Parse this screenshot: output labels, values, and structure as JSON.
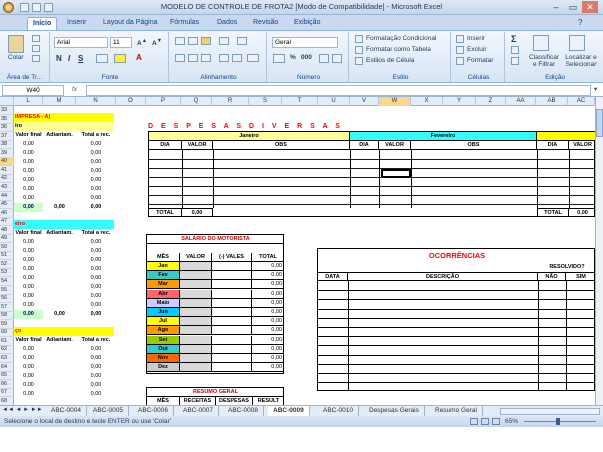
{
  "window": {
    "title": "MODELO DE CONTROLE DE FROTA2  [Modo de Compatibilidade] - Microsoft Excel"
  },
  "ribbon_tabs": [
    "Início",
    "Inserir",
    "Layout da Página",
    "Fórmulas",
    "Dados",
    "Revisão",
    "Exibição"
  ],
  "ribbon": {
    "paste": "Colar",
    "font_name": "Arial",
    "font_size": "11",
    "number_format": "Geral",
    "cond_format": "Formatação Condicional",
    "table_format": "Formatar como Tabela",
    "cell_styles": "Estilos de Célula",
    "insert": "Inserir",
    "delete": "Excluir",
    "format": "Formatar",
    "sort": "Classificar e Filtrar",
    "find": "Localizar e Selecionar",
    "groups": {
      "clipboard": "Área de Tr...",
      "font": "Fonte",
      "align": "Alinhamento",
      "number": "Número",
      "style": "Estilo",
      "cells": "Células",
      "edit": "Edição"
    }
  },
  "formula_bar": {
    "name_box": "W40",
    "fx": "fx"
  },
  "columns": [
    "L",
    "M",
    "N",
    "O",
    "P",
    "Q",
    "R",
    "S",
    "T",
    "U",
    "V",
    "W",
    "X",
    "Y",
    "Z",
    "AA",
    "AB",
    "AC"
  ],
  "rows": [
    "33",
    "35",
    "36",
    "37",
    "38",
    "39",
    "40",
    "41",
    "42",
    "43",
    "44",
    "45",
    "46",
    "47",
    "48",
    "49",
    "50",
    "51",
    "52",
    "53",
    "54",
    "55",
    "56",
    "57",
    "58",
    "59",
    "60",
    "61",
    "62",
    "63",
    "64",
    "65",
    "66",
    "67",
    "68"
  ],
  "left_block": {
    "title1": "IMPRESA - A)",
    "sub1": "iro",
    "sub2": "eiro",
    "sub3": "ço",
    "headers": [
      "Valor final",
      "Adiantam.",
      "Total a rec."
    ],
    "zero": "0,00",
    "total_row": [
      "0,00",
      "0,00",
      "0,00"
    ]
  },
  "despesas": {
    "title": "D E S P E S A S     D I V E R S A S",
    "months": [
      "Janeiro",
      "Fevereiro"
    ],
    "headers": [
      "DIA",
      "VALOR",
      "OBS",
      "DIA",
      "VALOR",
      "OBS",
      "DIA",
      "VALOR"
    ],
    "total_label": "TOTAL",
    "total_value": "0,00"
  },
  "salario": {
    "title": "SALÁRIO DO MOTORISTA",
    "headers": [
      "MÊS",
      "VALOR",
      "(-) VALES",
      "TOTAL"
    ],
    "months": [
      "Jan",
      "Fev",
      "Mar",
      "Abr",
      "Maio",
      "Jun",
      "Jul",
      "Ago",
      "Set",
      "Out",
      "Nov",
      "Dez"
    ],
    "month_colors": [
      "#ffff00",
      "#33cccc",
      "#ff9900",
      "#ff6666",
      "#ccccff",
      "#00ccff",
      "#ffff00",
      "#ff9900",
      "#99cc00",
      "#33cccc",
      "#ff6600",
      "#cccccc"
    ],
    "total": "0,00"
  },
  "ocorrencias": {
    "title": "OCORRÊNCIAS",
    "resolvido": "RESOLVIDO?",
    "headers": [
      "DATA",
      "DESCRIÇÃO",
      "NÃO",
      "SIM"
    ]
  },
  "resumo": {
    "title": "RESUMO GERAL",
    "headers": [
      "MÊS",
      "RECEITAS",
      "DESPESAS",
      "RESULT"
    ]
  },
  "sheet_tabs": [
    "ABC-0004",
    "ABC-0005",
    "ABC-0006",
    "ABC-0007",
    "ABC-0008",
    "ABC-0009",
    "ABC-0010",
    "Despesas Gerais",
    "Resumo Geral"
  ],
  "active_sheet": "ABC-0009",
  "status": {
    "message": "Selecione o local de destino e tecle ENTER ou use 'Colar'",
    "zoom": "65%"
  },
  "colors": {
    "ribbon": "#d7e4f4",
    "header_cyan": "#33ffff",
    "header_yellow": "#ffff99",
    "title_red": "#ff0000",
    "left_yellow": "#ffff00"
  }
}
